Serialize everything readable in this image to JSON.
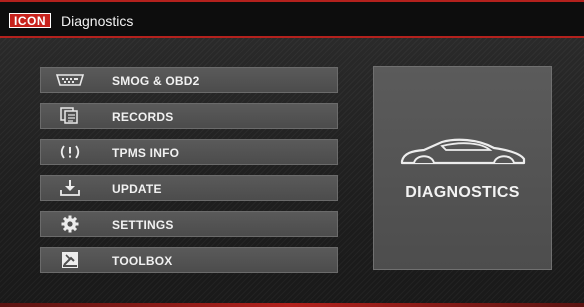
{
  "titlebar": {
    "logo_text": "ICON",
    "title": "Diagnostics"
  },
  "menu": [
    {
      "label": "SMOG & OBD2",
      "icon": "obd-connector-icon"
    },
    {
      "label": "RECORDS",
      "icon": "records-icon"
    },
    {
      "label": "TPMS INFO",
      "icon": "tpms-icon"
    },
    {
      "label": "UPDATE",
      "icon": "download-icon"
    },
    {
      "label": "SETTINGS",
      "icon": "gear-icon"
    },
    {
      "label": "TOOLBOX",
      "icon": "toolbox-icon"
    }
  ],
  "panel": {
    "label": "DIAGNOSTICS",
    "icon": "car-icon"
  },
  "colors": {
    "accent": "#b3211d",
    "logo_bg": "#c7221c",
    "button_bg": "#555555",
    "text": "#f1f1f1"
  }
}
